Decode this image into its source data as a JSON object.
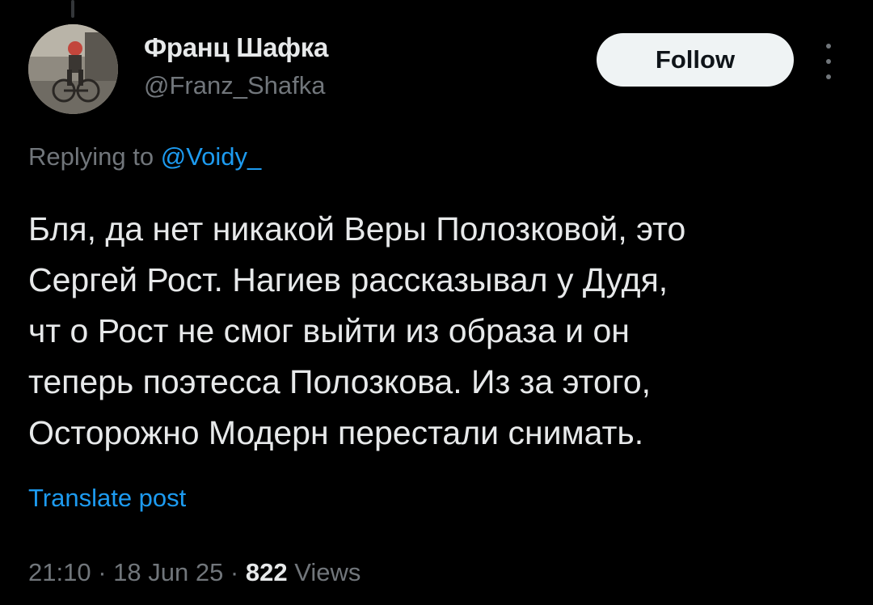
{
  "author": {
    "name": "Франц Шафка",
    "handle": "@Franz_Shafka"
  },
  "follow_label": "Follow",
  "reply": {
    "prefix": "Replying to ",
    "to_handle": "@Voidy_"
  },
  "tweet": {
    "lines": [
      "Бля, да нет никакой Веры Полозковой, это",
      "Сергей Рост. Нагиев рассказывал у Дудя,",
      "чт о Рост не смог выйти из образа и он",
      "теперь поэтесса Полозкова. Из за этого,",
      "Осторожно Модерн перестали снимать."
    ]
  },
  "translate_label": "Translate post",
  "meta": {
    "time": "21:10",
    "separator": " · ",
    "date": "18 Jun 25",
    "views_count": "822",
    "views_label": " Views"
  },
  "colors": {
    "background": "#000000",
    "text": "#e7e9ea",
    "secondary": "#71767b",
    "link": "#1d9bf0",
    "follow_bg": "#eff3f4"
  }
}
